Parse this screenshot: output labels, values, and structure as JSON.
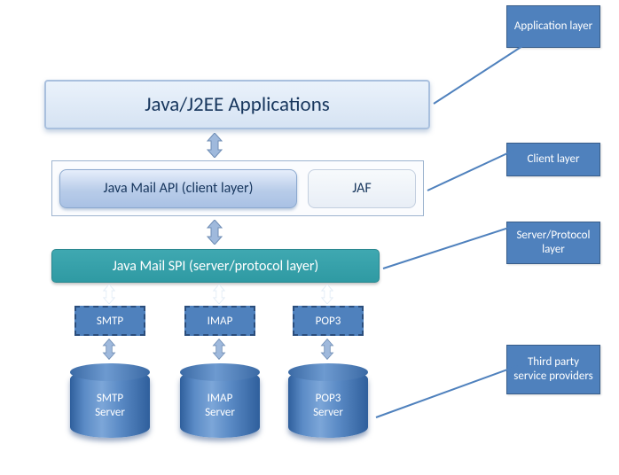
{
  "labels": {
    "application": "Application layer",
    "client": "Client layer",
    "server_protocol": "Server/Protocol layer",
    "third_party": "Third party service providers"
  },
  "boxes": {
    "app": "Java/J2EE Applications",
    "api": "Java Mail API (client layer)",
    "jaf": "JAF",
    "spi": "Java Mail SPI (server/protocol layer)"
  },
  "protocols": {
    "p1": "SMTP",
    "p2": "IMAP",
    "p3": "POP3"
  },
  "servers": {
    "s1a": "SMTP",
    "s1b": "Server",
    "s2a": "IMAP",
    "s2b": "Server",
    "s3a": "POP3",
    "s3b": "Server"
  }
}
